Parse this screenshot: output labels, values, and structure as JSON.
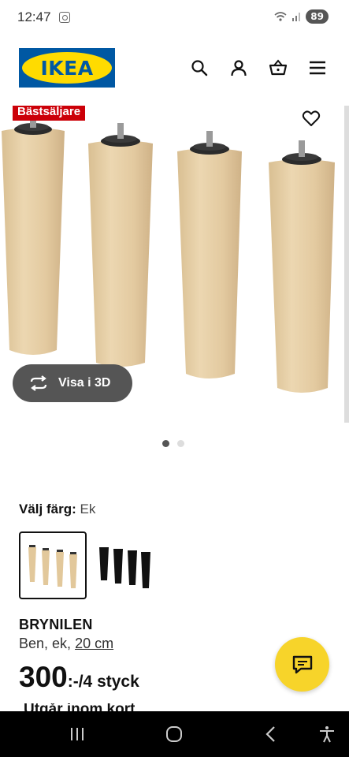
{
  "status_bar": {
    "time": "12:47",
    "battery": "89"
  },
  "header": {
    "logo_text": "IKEA",
    "icons": [
      "search-icon",
      "user-icon",
      "basket-icon",
      "menu-icon"
    ]
  },
  "gallery": {
    "badge": "Bästsäljare",
    "view_3d_label": "Visa i 3D",
    "page_count": 2,
    "active_index": 0
  },
  "color_select": {
    "label": "Välj färg:",
    "value": "Ek",
    "options": [
      "Ek",
      "Svart"
    ]
  },
  "product": {
    "name": "BRYNILEN",
    "desc_prefix": "Ben, ek,",
    "desc_size": "20 cm",
    "price": "300",
    "price_unit": ":-/4 styck",
    "availability": "Utgår inom kort"
  },
  "colors": {
    "ikea_blue": "#0058a3",
    "ikea_yellow": "#ffdb00",
    "badge_red": "#cc0008",
    "chat_yellow": "#f7d42a",
    "wood": "#e6cfa6"
  }
}
